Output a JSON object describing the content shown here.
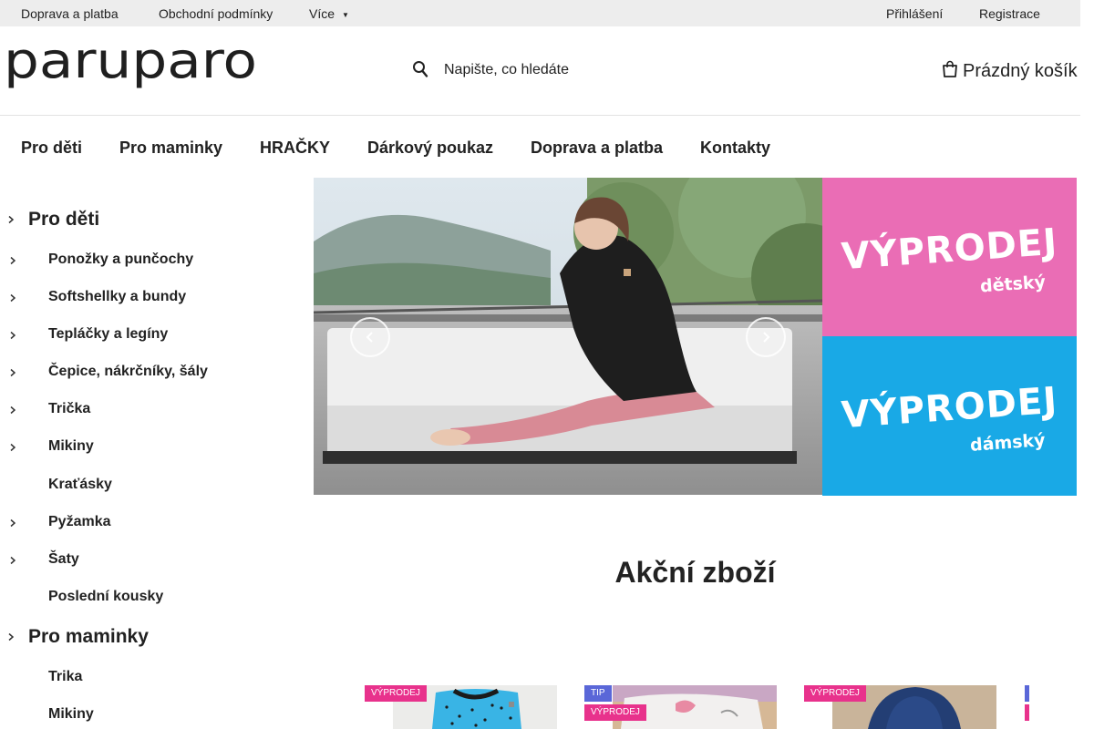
{
  "topbar": {
    "links": [
      "Doprava a platba",
      "Obchodní podmínky",
      "Více"
    ],
    "more_caret": "▼",
    "login": "Přihlášení",
    "register": "Registrace"
  },
  "header": {
    "logo_text": "paruparo",
    "search_placeholder": "Napište, co hledáte",
    "cart_label": "Prázdný košík"
  },
  "nav": {
    "items": [
      "Pro děti",
      "Pro maminky",
      "HRAČKY",
      "Dárkový poukaz",
      "Doprava a platba",
      "Kontakty"
    ]
  },
  "sidebar": {
    "kids": {
      "title": "Pro děti",
      "items": [
        "Ponožky a punčochy",
        "Softshellky a bundy",
        "Tepláčky a legíny",
        "Čepice, nákrčníky, šály",
        "Trička",
        "Mikiny",
        "Kraťásky",
        "Pyžamka",
        "Šaty",
        "Poslední kousky"
      ]
    },
    "moms": {
      "title": "Pro maminky",
      "items": [
        "Trika",
        "Mikiny"
      ]
    }
  },
  "banners": {
    "kids": {
      "title": "VÝPRODEJ",
      "subtitle": "dětský"
    },
    "ladies": {
      "title": "VÝPRODEJ",
      "subtitle": "dámský"
    }
  },
  "section_title": "Akční zboží",
  "badges": {
    "sale": "VÝPRODEJ",
    "tip": "TIP"
  },
  "colors": {
    "kids_banner": "#ea6db5",
    "ladies_banner": "#19a9e6",
    "sale_badge": "#e8328c",
    "tip_badge": "#5a67d8"
  }
}
